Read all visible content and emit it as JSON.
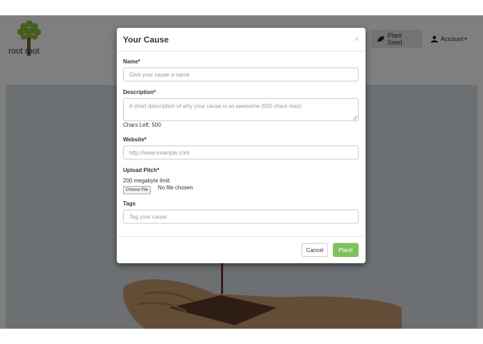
{
  "navbar": {
    "logo_text": "root root",
    "plant_seed_label": "Plant Seed",
    "account_label": "Account"
  },
  "modal": {
    "title": "Your Cause",
    "close_glyph": "×",
    "name_label": "Name*",
    "name_placeholder": "Give your cause a name",
    "description_label": "Description*",
    "description_placeholder": "A short description of why your cause is so awesome (500 chars max)",
    "chars_left": "Chars Left: 500",
    "website_label": "Website*",
    "website_placeholder": "http://www.example.com",
    "upload_label": "Upload Pitch*",
    "upload_limit": "200 megabyte limit",
    "choose_file_label": "Choose File",
    "no_file_text": "No file chosen",
    "tags_label": "Tags",
    "tags_placeholder": "Tag your cause",
    "cancel_label": "Cancel",
    "plant_label": "Plant!"
  },
  "colors": {
    "accent": "#7cc35c",
    "hero_bg": "#d9e1e6",
    "backdrop": "rgba(0,0,0,0.5)"
  }
}
